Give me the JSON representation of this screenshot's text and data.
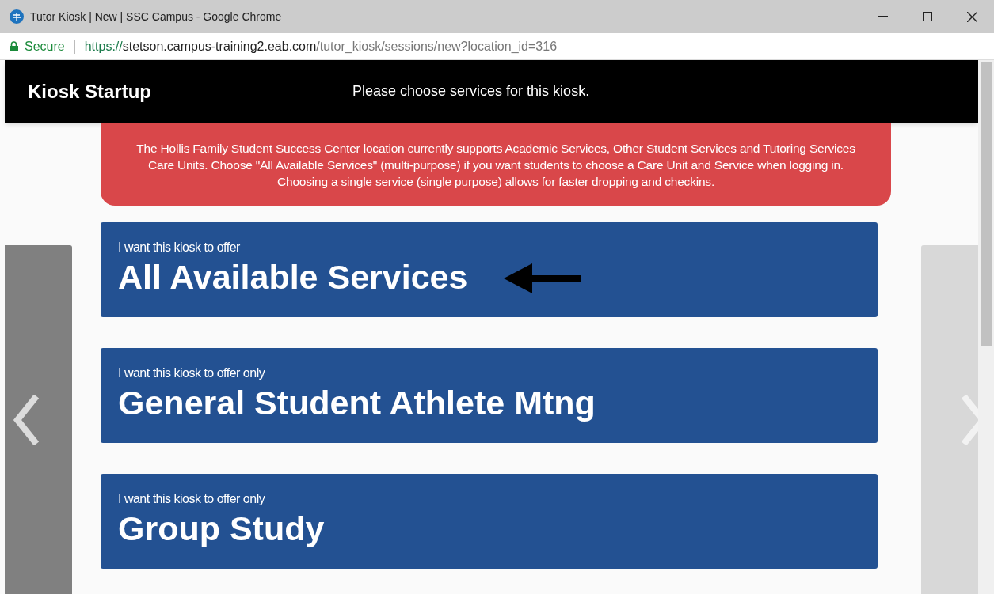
{
  "window": {
    "title": "Tutor Kiosk | New | SSC Campus - Google Chrome"
  },
  "address_bar": {
    "security": "Secure",
    "url_host": "https://stetson.campus-training2.eab.com",
    "url_path": "/tutor_kiosk/sessions/new?location_id=316"
  },
  "header": {
    "title": "Kiosk Startup",
    "subtitle": "Please choose services for this kiosk."
  },
  "notice": "The Hollis Family Student Success Center location currently supports Academic Services, Other Student Services and Tutoring Services Care Units. Choose \"All Available Services\" (multi-purpose) if you want students to choose a Care Unit and Service when logging in. Choosing a single service (single purpose) allows for faster dropping and checkins.",
  "options": [
    {
      "intro": "I want this kiosk to offer",
      "service": "All Available Services",
      "annotated": true
    },
    {
      "intro": "I want this kiosk to offer only",
      "service": "General Student Athlete Mtng",
      "annotated": false
    },
    {
      "intro": "I want this kiosk to offer only",
      "service": "Group Study",
      "annotated": false
    }
  ]
}
